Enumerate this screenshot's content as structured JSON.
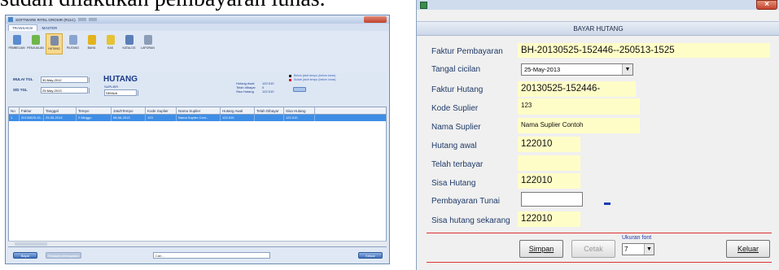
{
  "doc_text": "sudah dilakukan pembayaran lunas.",
  "left_window": {
    "title": "SOFTWARE RITEL GROSIR (R11C)",
    "tabs": [
      "TRANSAKSI",
      "MASTER"
    ],
    "ribbon": [
      {
        "label": "PEMBELIAN",
        "icon": "truck-icon",
        "color": "#5b8bd1"
      },
      {
        "label": "PENJUALAN",
        "icon": "cart-icon",
        "color": "#6fb64a"
      },
      {
        "label": "HUTANG",
        "icon": "document-icon",
        "color": "#7b8aa8"
      },
      {
        "label": "PIUTANG",
        "icon": "receipt-icon",
        "color": "#8aa4cf"
      },
      {
        "label": "BIAYA",
        "icon": "gear-icon",
        "color": "#e3b21d"
      },
      {
        "label": "KAS",
        "icon": "cash-icon",
        "color": "#e6c234"
      },
      {
        "label": "KATALOG",
        "icon": "magnifier-icon",
        "color": "#5a7fb8"
      },
      {
        "label": "LAPORAN",
        "icon": "report-icon",
        "color": "#8c9db8"
      }
    ],
    "filter": {
      "mulai_label": "MULAI TGL",
      "mulai_value": "30-May-2012",
      "sd_label": "S/D TGL",
      "sd_value": "25-May-2013",
      "page_title": "HUTANG",
      "suplier_label": "SUPLIER",
      "suplier_value": "SEMUA",
      "hutang_awal_label": "Hutang Awal",
      "hutang_awal_value": "122.010",
      "telah_dibayar_label": "Telah dibayar",
      "telah_dibayar_value": "0",
      "sisa_hutang_label": "Sisa Hutang",
      "sisa_hutang_value": "122.010",
      "legend_1": "Belum jatuh tempo (belum lunas)",
      "legend_2": "Sudah jatuh tempo (belum lunas)"
    },
    "columns": [
      "No",
      "Faktur",
      "Tanggal",
      "Tempo",
      "JatuhTempo",
      "Kode Suplier",
      "Nama Suplier",
      "Hutang Awal",
      "Telah Dibayar",
      "Sisa Hutang"
    ],
    "rows": [
      [
        "1",
        "20130525-15...",
        "25-05-2013",
        "2 Minggu",
        "08-06-2013",
        "123",
        "Nama Suplier Cont...",
        "122.010",
        "",
        "122.010"
      ]
    ],
    "footer": {
      "bayar_label": "Bayar",
      "riwayat_label": "Riwayat pembayaran",
      "search_placeholder": "Cari...",
      "keluar_label": "Keluar"
    }
  },
  "right_window": {
    "header": "BAYAR HUTANG",
    "fields": {
      "faktur_pembayaran_label": "Faktur Pembayaran",
      "faktur_pembayaran_value": "BH-20130525-152446--250513-1525",
      "tanggal_cicilan_label": "Tangal cicilan",
      "tanggal_cicilan_value": "25-May-2013",
      "faktur_hutang_label": "Faktur Hutang",
      "faktur_hutang_value": "20130525-152446-",
      "kode_suplier_label": "Kode Suplier",
      "kode_suplier_value": "123",
      "nama_suplier_label": "Nama Suplier",
      "nama_suplier_value": "Nama Suplier Contoh",
      "hutang_awal_label": "Hutang awal",
      "hutang_awal_value": "122010",
      "telah_terbayar_label": "Telah terbayar",
      "telah_terbayar_value": "",
      "sisa_hutang_label": "Sisa Hutang",
      "sisa_hutang_value": "122010",
      "pembayaran_tunai_label": "Pembayaran Tunai",
      "pembayaran_tunai_value": "",
      "sisa_sekarang_label": "Sisa hutang sekarang",
      "sisa_sekarang_value": "122010"
    },
    "buttons": {
      "simpan": "Simpan",
      "cetak": "Cetak",
      "keluar": "Keluar"
    },
    "ukuran_font_label": "Ukuran font",
    "ukuran_font_value": "7"
  },
  "colors": {
    "field_bg": "#fffdc7",
    "selected_row": "#3f8ee6",
    "header_text": "#1b3a8a",
    "separator": "#e03030"
  }
}
